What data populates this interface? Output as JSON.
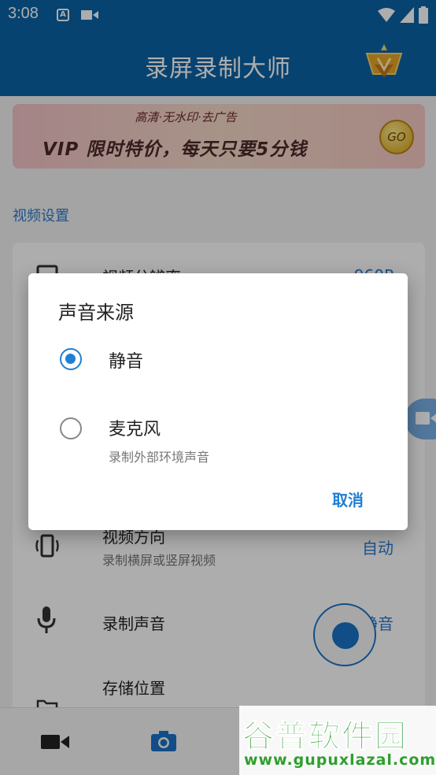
{
  "status_bar": {
    "time": "3:08",
    "icons": [
      "font-icon",
      "video-camera-icon",
      "wifi-icon",
      "signal-icon",
      "battery-icon"
    ]
  },
  "app_bar": {
    "title": "录屏录制大师",
    "vip_icon": "vip-crown-icon"
  },
  "banner": {
    "subtitle": "高清·无水印·去广告",
    "headline": "VIP 限时特价，每天只要5分钱",
    "go_label": "GO"
  },
  "section": {
    "title": "视频设置"
  },
  "settings": {
    "resolution": {
      "title": "视频分辨率",
      "value": "960P",
      "icon": "hd-icon"
    },
    "orientation": {
      "title": "视频方向",
      "subtitle": "录制横屏或竖屏视频",
      "value": "自动",
      "icon": "screen-rotation-icon"
    },
    "audio": {
      "title": "录制声音",
      "value": "静音",
      "icon": "microphone-icon"
    },
    "storage": {
      "title": "存储位置",
      "icon": "folder-icon"
    }
  },
  "bottom_nav": {
    "items": [
      "video-tab-icon",
      "camera-tab-icon"
    ]
  },
  "dialog": {
    "title": "声音来源",
    "options": [
      {
        "label": "静音",
        "subtitle": "",
        "selected": true
      },
      {
        "label": "麦克风",
        "subtitle": "录制外部环境声音",
        "selected": false
      }
    ],
    "cancel_label": "取消"
  },
  "watermark": {
    "title": "谷普软件园",
    "url": "www.gupuxlazal.com"
  },
  "colors": {
    "primary": "#0b63a6",
    "accent": "#1f7fd6",
    "scrim": "rgba(0,0,0,0.32)"
  }
}
